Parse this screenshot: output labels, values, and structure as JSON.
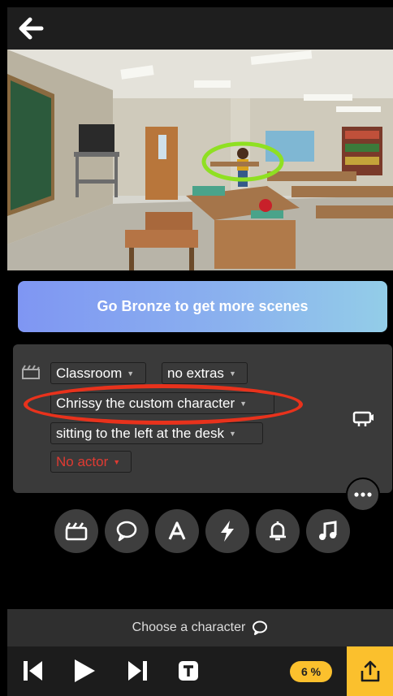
{
  "promo": {
    "label": "Go Bronze to get more scenes"
  },
  "editor": {
    "location": "Classroom",
    "extras": "no extras",
    "character": "Chrissy the custom character",
    "pose": "sitting to the left at the desk",
    "actor": "No actor"
  },
  "hint": {
    "text": "Choose a character"
  },
  "progress": {
    "label": "6 %",
    "value": 6
  },
  "colors": {
    "accent": "#fbc02d",
    "highlight_ring": "#e8321c",
    "focus_ring": "#8fe022",
    "promo_start": "#7f96f3",
    "promo_end": "#93cde8",
    "error_red": "#e03a32"
  },
  "tools": [
    "scene-icon",
    "speech-bubble-icon",
    "text-icon",
    "lightning-icon",
    "bell-icon",
    "music-icon"
  ]
}
